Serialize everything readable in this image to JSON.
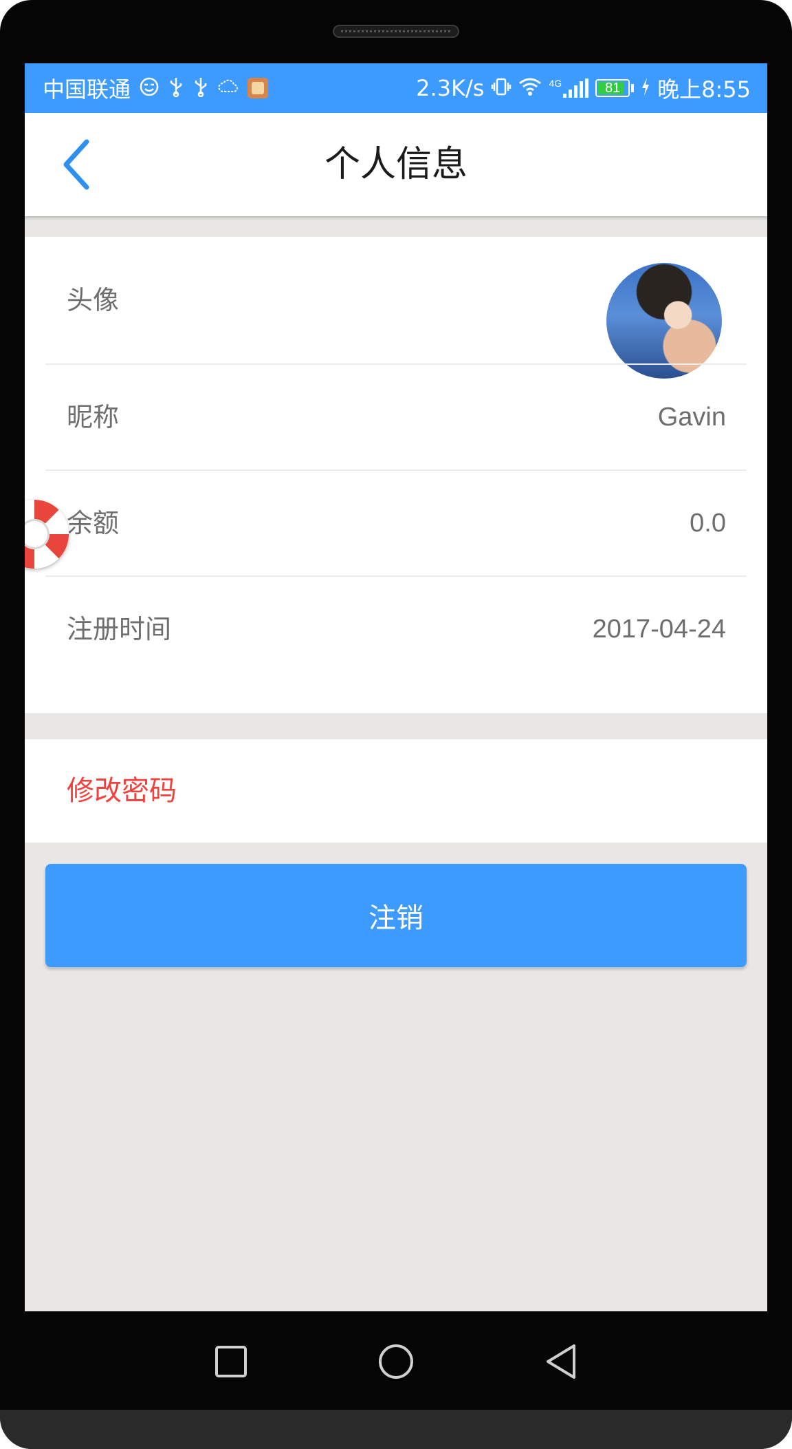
{
  "status_bar": {
    "carrier": "中国联通",
    "net_speed": "2.3K/s",
    "network_type": "4G",
    "battery_level": "81",
    "time": "晚上8:55",
    "color": "#3d9bff",
    "icons": [
      "smile-face-icon",
      "usb-icon",
      "usb-icon",
      "cloud-icon",
      "app-notification-icon",
      "vibrate-icon",
      "wifi-icon",
      "signal-icon",
      "battery-icon",
      "charging-icon"
    ]
  },
  "header": {
    "title": "个人信息",
    "back_icon": "chevron-left-icon"
  },
  "profile": {
    "avatar_label": "头像",
    "nickname_label": "昵称",
    "nickname_value": "Gavin",
    "balance_label": "余额",
    "balance_value": "0.0",
    "register_label": "注册时间",
    "register_value": "2017-04-24"
  },
  "actions": {
    "change_password": "修改密码",
    "logout": "注销"
  },
  "colors": {
    "accent": "#3d9bff",
    "danger_text": "#f2413d",
    "page_bg": "#e8e7e6"
  },
  "nav_bar": {
    "icons": [
      "recent-apps-icon",
      "home-icon",
      "back-triangle-icon"
    ]
  }
}
